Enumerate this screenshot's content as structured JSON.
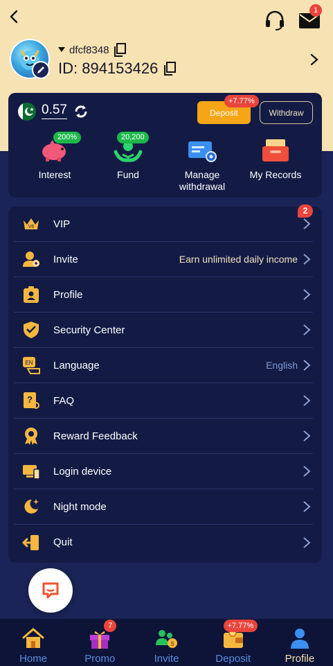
{
  "header": {
    "username": "dfcf8348",
    "user_id": "ID: 894153426",
    "mail_badge": "1"
  },
  "wallet": {
    "balance": "0.57",
    "deposit_label": "Deposit",
    "deposit_bonus": "+7.77%",
    "withdraw_label": "Withdraw"
  },
  "quick_actions": [
    {
      "label": "Interest",
      "badge": "200%",
      "icon": "piggy-bank-icon"
    },
    {
      "label": "Fund",
      "badge": "20,200",
      "icon": "fund-hands-icon"
    },
    {
      "label": "Manage withdrawal",
      "badge": "",
      "icon": "card-settings-icon"
    },
    {
      "label": "My Records",
      "badge": "",
      "icon": "records-tray-icon"
    }
  ],
  "menu": [
    {
      "label": "VIP",
      "icon": "vip-crown-icon",
      "badge": "2",
      "extra": ""
    },
    {
      "label": "Invite",
      "icon": "invite-person-icon",
      "badge": "",
      "extra": "Earn unlimited daily income"
    },
    {
      "label": "Profile",
      "icon": "profile-badge-icon",
      "badge": "",
      "extra": ""
    },
    {
      "label": "Security Center",
      "icon": "shield-check-icon",
      "badge": "",
      "extra": ""
    },
    {
      "label": "Language",
      "icon": "language-en-icon",
      "badge": "",
      "extra": "English"
    },
    {
      "label": "FAQ",
      "icon": "faq-question-icon",
      "badge": "",
      "extra": ""
    },
    {
      "label": "Reward Feedback",
      "icon": "reward-medal-icon",
      "badge": "",
      "extra": ""
    },
    {
      "label": "Login device",
      "icon": "login-device-icon",
      "badge": "",
      "extra": ""
    },
    {
      "label": "Night mode",
      "icon": "moon-star-icon",
      "badge": "",
      "extra": ""
    },
    {
      "label": "Quit",
      "icon": "quit-door-icon",
      "badge": "",
      "extra": ""
    }
  ],
  "tabbar": [
    {
      "label": "Home",
      "icon": "home-icon",
      "badge": ""
    },
    {
      "label": "Promo",
      "icon": "gift-icon",
      "badge": "7"
    },
    {
      "label": "Invite",
      "icon": "invite-people-icon",
      "badge": ""
    },
    {
      "label": "Deposit",
      "icon": "wallet-icon",
      "badge": "+7.77%"
    },
    {
      "label": "Profile",
      "icon": "profile-person-icon",
      "badge": ""
    }
  ],
  "colors": {
    "header_bg": "#f6e2b2",
    "page_bg": "#1a2456",
    "card_bg": "#131b45",
    "accent_gold": "#f5a516",
    "badge_red": "#e8453c",
    "badge_green": "#1eb84a",
    "tab_inactive": "#5a8de0",
    "tab_active": "#f3dfae",
    "extra_invite": "#f1e3c0",
    "extra_language": "#7f9ad6"
  }
}
